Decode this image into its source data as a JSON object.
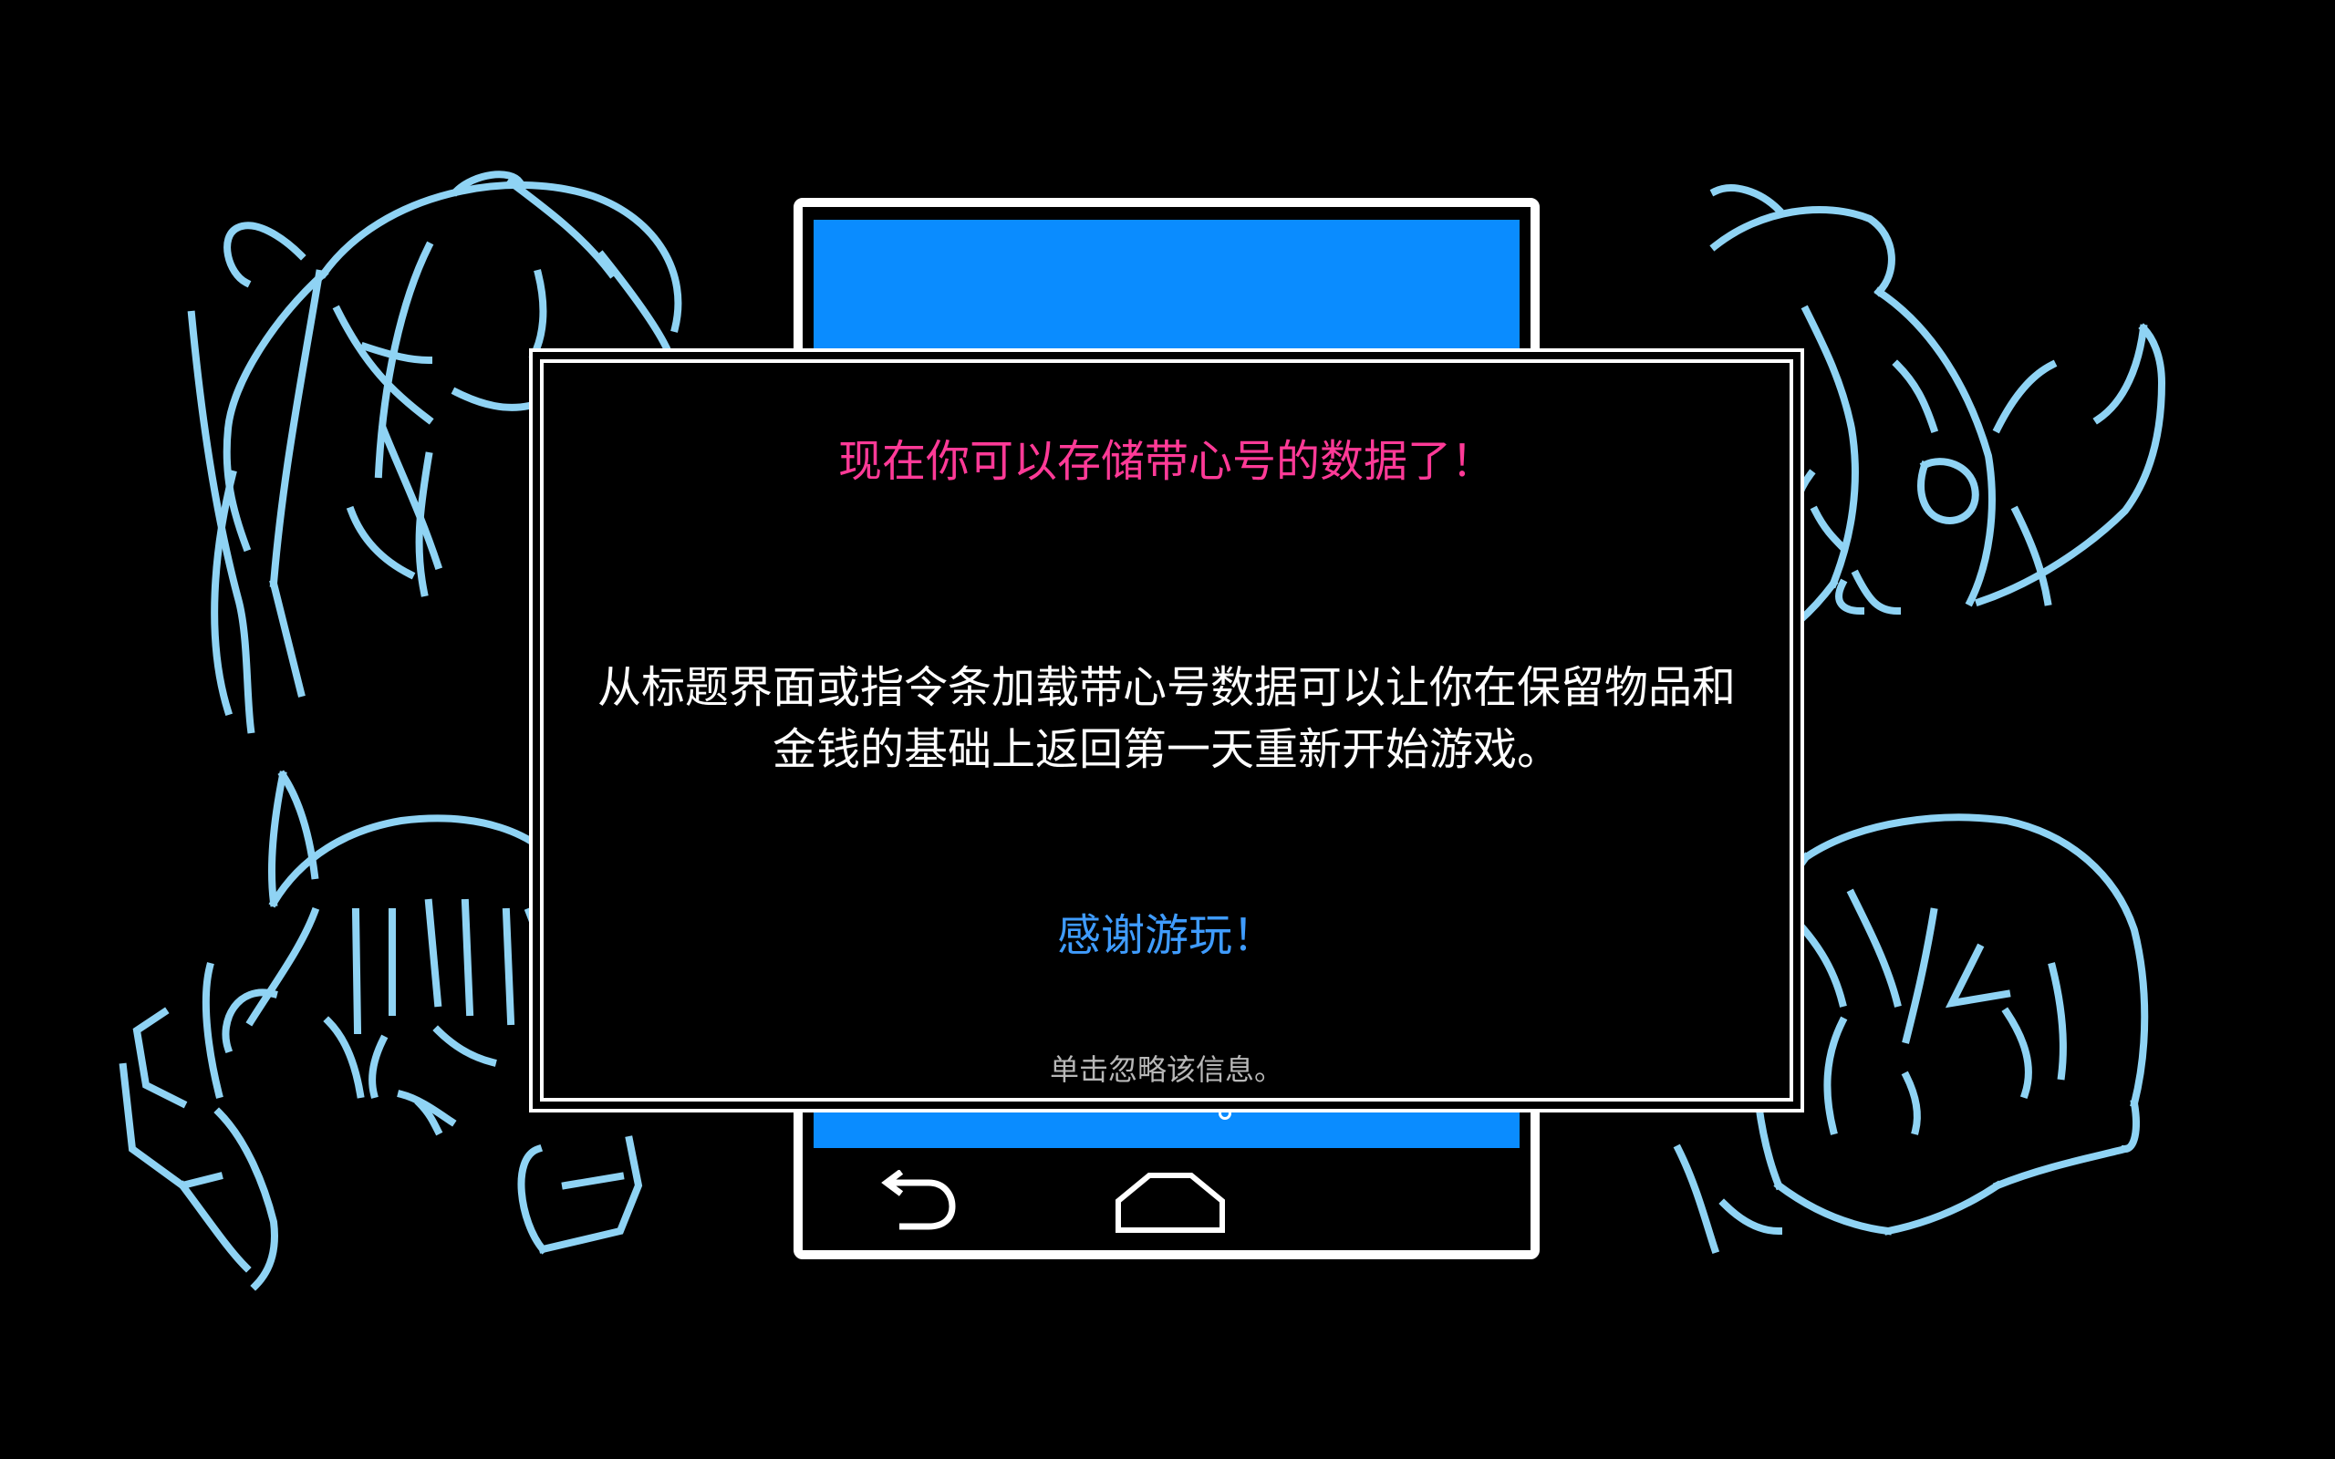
{
  "dialog": {
    "title": "现在你可以存储带心号的数据了！",
    "body": "从标题界面或指令条加载带心号数据可以让你在保留物品和金钱的基础上返回第一天重新开始游戏。",
    "thanks": "感谢游玩！",
    "dismiss_hint": "单击忽略该信息。"
  },
  "colors": {
    "background": "#000000",
    "sketch_lines": "#8fd3f4",
    "phone_screen": "#0a8cff",
    "title_text": "#ff3a97",
    "thanks_text": "#3f9cff",
    "hint_text": "#b8b8b8"
  },
  "icons": {
    "back": "back-arrow-icon",
    "home": "home-icon"
  }
}
